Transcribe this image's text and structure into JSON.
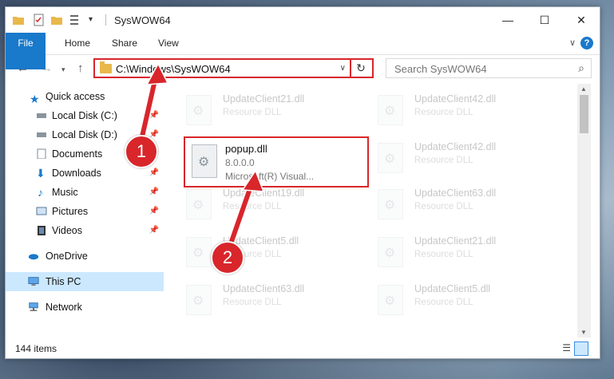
{
  "window": {
    "title": "SysWOW64"
  },
  "ribbon": {
    "tabs": [
      "File",
      "Home",
      "Share",
      "View"
    ]
  },
  "address": {
    "path": "C:\\Windows\\SysWOW64"
  },
  "search": {
    "placeholder": "Search SysWOW64"
  },
  "sidebar": {
    "items": [
      {
        "label": "Quick access",
        "icon": "star-icon"
      },
      {
        "label": "Local Disk (C:)",
        "icon": "drive-icon",
        "pinned": true
      },
      {
        "label": "Local Disk (D:)",
        "icon": "drive-icon",
        "pinned": true
      },
      {
        "label": "Documents",
        "icon": "documents-icon",
        "pinned": true
      },
      {
        "label": "Downloads",
        "icon": "downloads-icon",
        "pinned": true
      },
      {
        "label": "Music",
        "icon": "music-icon",
        "pinned": true
      },
      {
        "label": "Pictures",
        "icon": "pictures-icon",
        "pinned": true
      },
      {
        "label": "Videos",
        "icon": "videos-icon",
        "pinned": true
      },
      {
        "label": "OneDrive",
        "icon": "onedrive-icon"
      },
      {
        "label": "This PC",
        "icon": "pc-icon",
        "selected": true
      },
      {
        "label": "Network",
        "icon": "network-icon"
      }
    ]
  },
  "files": {
    "left": [
      {
        "name": "UpdateClient21.dll",
        "desc": "Resource DLL"
      },
      {
        "name": "UpdateClient19.dll",
        "desc": "Resource DLL"
      },
      {
        "name": "UpdateClient5.dll",
        "desc": "Resource DLL"
      },
      {
        "name": "UpdateClient63.dll",
        "desc": "Resource DLL"
      }
    ],
    "right": [
      {
        "name": "UpdateClient42.dll",
        "desc": "Resource DLL"
      },
      {
        "name": "UpdateClient42.dll",
        "desc": "Resource DLL"
      },
      {
        "name": "UpdateClient63.dll",
        "desc": "Resource DLL"
      },
      {
        "name": "UpdateClient21.dll",
        "desc": "Resource DLL"
      },
      {
        "name": "UpdateClient5.dll",
        "desc": "Resource DLL"
      }
    ]
  },
  "highlighted_file": {
    "name": "popup.dll",
    "version": "8.0.0.0",
    "company": "Microsoft(R) Visual..."
  },
  "status": {
    "item_count": "144 items"
  },
  "callouts": {
    "one": "1",
    "two": "2"
  },
  "colors": {
    "accent": "#1979ca",
    "highlight": "#d8262b",
    "selected": "#cce8ff"
  }
}
